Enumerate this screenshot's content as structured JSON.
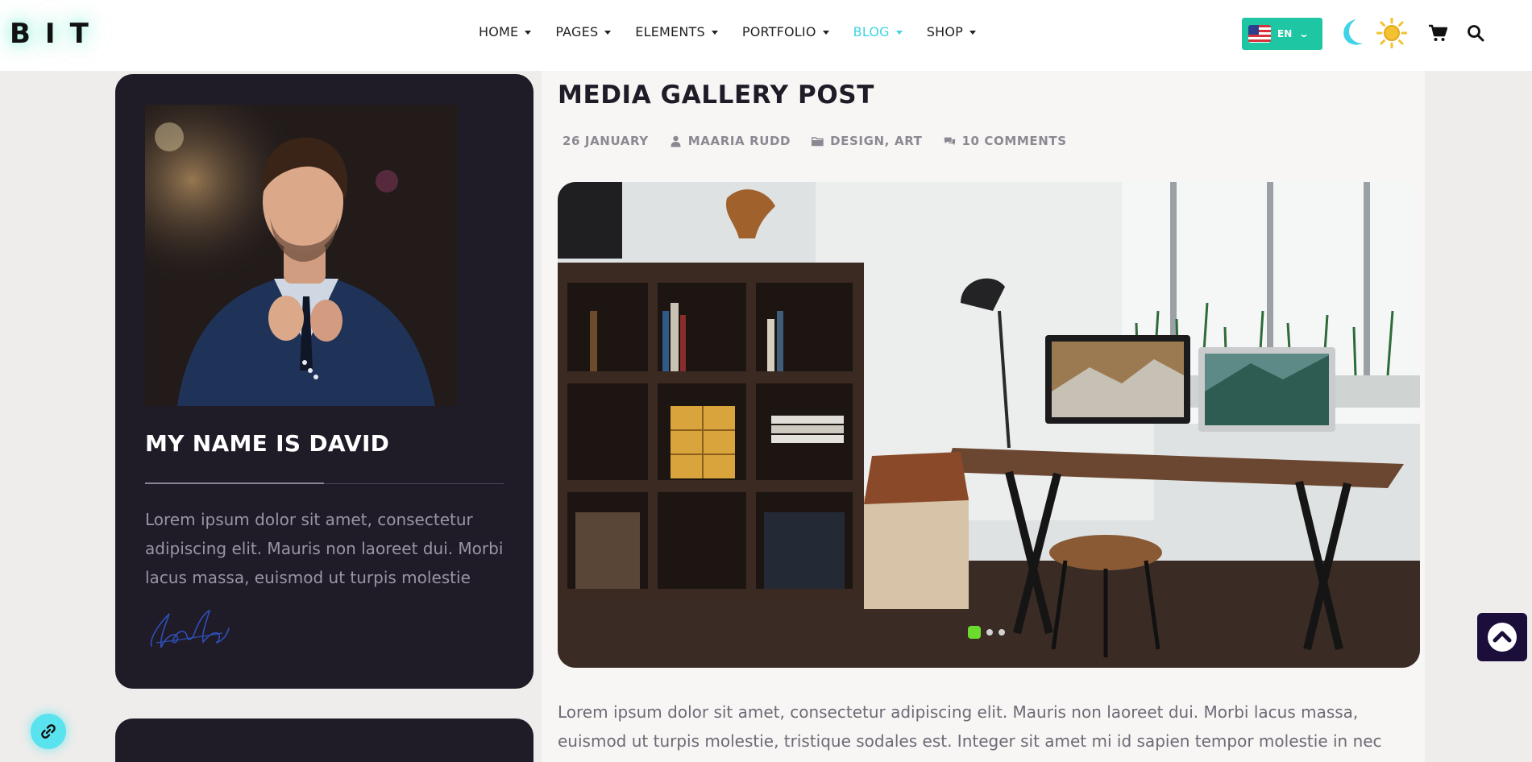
{
  "header": {
    "logo": "BIT",
    "nav": [
      {
        "label": "HOME"
      },
      {
        "label": "PAGES"
      },
      {
        "label": "ELEMENTS"
      },
      {
        "label": "PORTFOLIO"
      },
      {
        "label": "BLOG",
        "active": true
      },
      {
        "label": "SHOP"
      }
    ],
    "language": {
      "code": "EN",
      "flag": "us-flag-icon"
    },
    "icons": [
      "moon-icon",
      "sun-icon",
      "cart-icon",
      "search-icon"
    ]
  },
  "sidebar": {
    "name": "MY NAME IS DAVID",
    "bio": "Lorem ipsum dolor sit amet, consectetur adipiscing elit. Mauris non laoreet dui. Morbi lacus massa, euismod ut turpis molestie",
    "signature": "handwritten-signature"
  },
  "post": {
    "title": "MEDIA GALLERY POST",
    "meta": {
      "date": "26 JANUARY",
      "author": "MAARIA RUDD",
      "cat_1": "DESIGN",
      "cat_sep": ",",
      "cat_2": "ART",
      "comments": "10 COMMENTS"
    },
    "gallery": {
      "slides": 3,
      "active_slide": 1
    },
    "body": "Lorem ipsum dolor sit amet, consectetur adipiscing elit. Mauris non laoreet dui. Morbi lacus massa, euismod ut turpis molestie, tristique sodales est. Integer sit amet mi id sapien tempor molestie in nec"
  },
  "colors": {
    "accent": "#3ed3e6",
    "lang_button": "#1fc6a3",
    "card_bg": "#1f1c28",
    "slider_active_dot": "#6bdc2e",
    "back_to_top": "#1c0e3a"
  }
}
